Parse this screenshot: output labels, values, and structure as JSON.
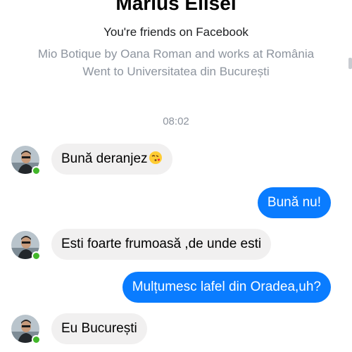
{
  "profile": {
    "name": "Marius Elisei",
    "friends_text": "You're friends on Facebook",
    "work": "Mio Botique by Oana Roman and works at România",
    "school": "Went to Universitatea din București"
  },
  "conversation": {
    "timestamp": "08:02",
    "messages": [
      {
        "direction": "incoming",
        "text": "Bună deranjez",
        "emoji": "kissing-heart-emoji"
      },
      {
        "direction": "outgoing",
        "text": "Bună nu!"
      },
      {
        "direction": "incoming",
        "text": "Esti foarte frumoasă ,de unde esti"
      },
      {
        "direction": "outgoing",
        "text": "Mulțumesc lafel din Oradea,uh?"
      },
      {
        "direction": "incoming",
        "text": "Eu București"
      }
    ]
  },
  "colors": {
    "outgoing_bubble": "#0a7cff",
    "incoming_bubble": "#f1f0f0",
    "online_indicator": "#42b72a",
    "secondary_text": "#8d949e"
  }
}
